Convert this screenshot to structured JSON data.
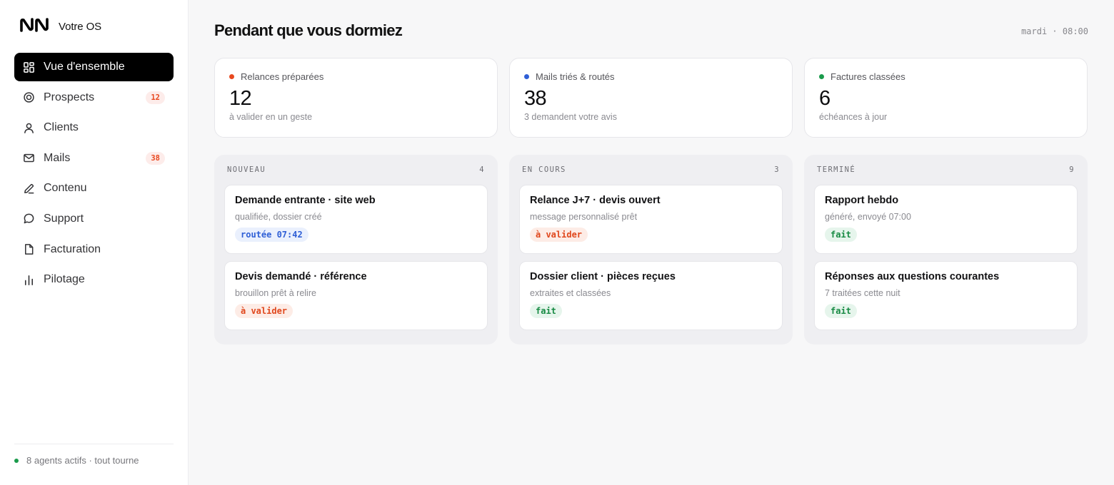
{
  "brand": {
    "name": "Votre OS"
  },
  "sidebar": {
    "items": [
      {
        "label": "Vue d'ensemble",
        "icon": "grid-icon",
        "active": true
      },
      {
        "label": "Prospects",
        "icon": "target-icon",
        "badge": "12"
      },
      {
        "label": "Clients",
        "icon": "user-icon"
      },
      {
        "label": "Mails",
        "icon": "mail-icon",
        "badge": "38"
      },
      {
        "label": "Contenu",
        "icon": "pencil-icon"
      },
      {
        "label": "Support",
        "icon": "chat-bubble-icon"
      },
      {
        "label": "Facturation",
        "icon": "document-icon"
      },
      {
        "label": "Pilotage",
        "icon": "bar-chart-icon"
      }
    ],
    "status": "8 agents actifs · tout tourne"
  },
  "header": {
    "title": "Pendant que vous dormiez",
    "time": "mardi · 08:00"
  },
  "stats": [
    {
      "label": "Relances préparées",
      "value": "12",
      "sub": "à valider en un geste",
      "color": "#e8481f"
    },
    {
      "label": "Mails triés & routés",
      "value": "38",
      "sub": "3 demandent votre avis",
      "color": "#2f5fd6"
    },
    {
      "label": "Factures classées",
      "value": "6",
      "sub": "échéances à jour",
      "color": "#1a9b4b"
    }
  ],
  "columns": [
    {
      "title": "NOUVEAU",
      "count": "4",
      "cards": [
        {
          "title": "Demande entrante · site web",
          "sub": "qualifiée, dossier créé",
          "tag": "routée 07:42",
          "tag_color": "blue"
        },
        {
          "title": "Devis demandé · référence",
          "sub": "brouillon prêt à relire",
          "tag": "à valider",
          "tag_color": "orange"
        }
      ]
    },
    {
      "title": "EN COURS",
      "count": "3",
      "cards": [
        {
          "title": "Relance J+7 · devis ouvert",
          "sub": "message personnalisé prêt",
          "tag": "à valider",
          "tag_color": "orange"
        },
        {
          "title": "Dossier client · pièces reçues",
          "sub": "extraites et classées",
          "tag": "fait",
          "tag_color": "green"
        }
      ]
    },
    {
      "title": "TERMINÉ",
      "count": "9",
      "cards": [
        {
          "title": "Rapport hebdo",
          "sub": "généré, envoyé 07:00",
          "tag": "fait",
          "tag_color": "green"
        },
        {
          "title": "Réponses aux questions courantes",
          "sub": "7 traitées cette nuit",
          "tag": "fait",
          "tag_color": "green"
        }
      ]
    }
  ]
}
